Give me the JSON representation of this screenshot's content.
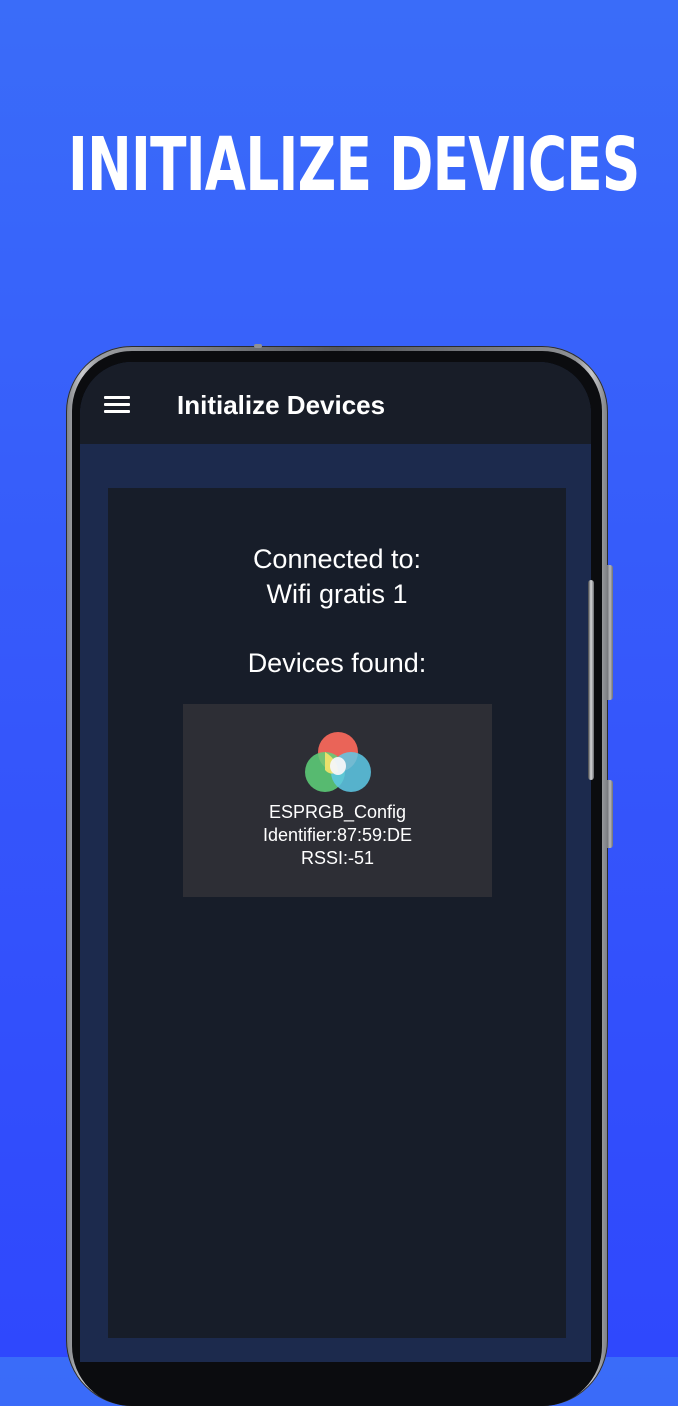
{
  "promo": {
    "headline": "INITIALIZE DEVICES"
  },
  "appbar": {
    "menu_icon": "hamburger-menu-icon",
    "title": "Initialize Devices"
  },
  "connection": {
    "label": "Connected to:",
    "network_name": "Wifi gratis 1"
  },
  "devices": {
    "label": "Devices found:",
    "items": [
      {
        "icon": "rgb-circles-icon",
        "name": "ESPRGB_Config",
        "identifier": "Identifier:87:59:DE",
        "rssi": "RSSI:-51"
      }
    ]
  },
  "colors": {
    "background_top": "#3a6cf9",
    "background_bottom": "#2f48fd",
    "appbar": "#181d28",
    "screen_bg": "#1c2a4d",
    "panel": "#171d29",
    "card": "#2d2e35",
    "icon_red": "#ff6a5c",
    "icon_green": "#5fd27a",
    "icon_cyan": "#5ec9e6"
  }
}
